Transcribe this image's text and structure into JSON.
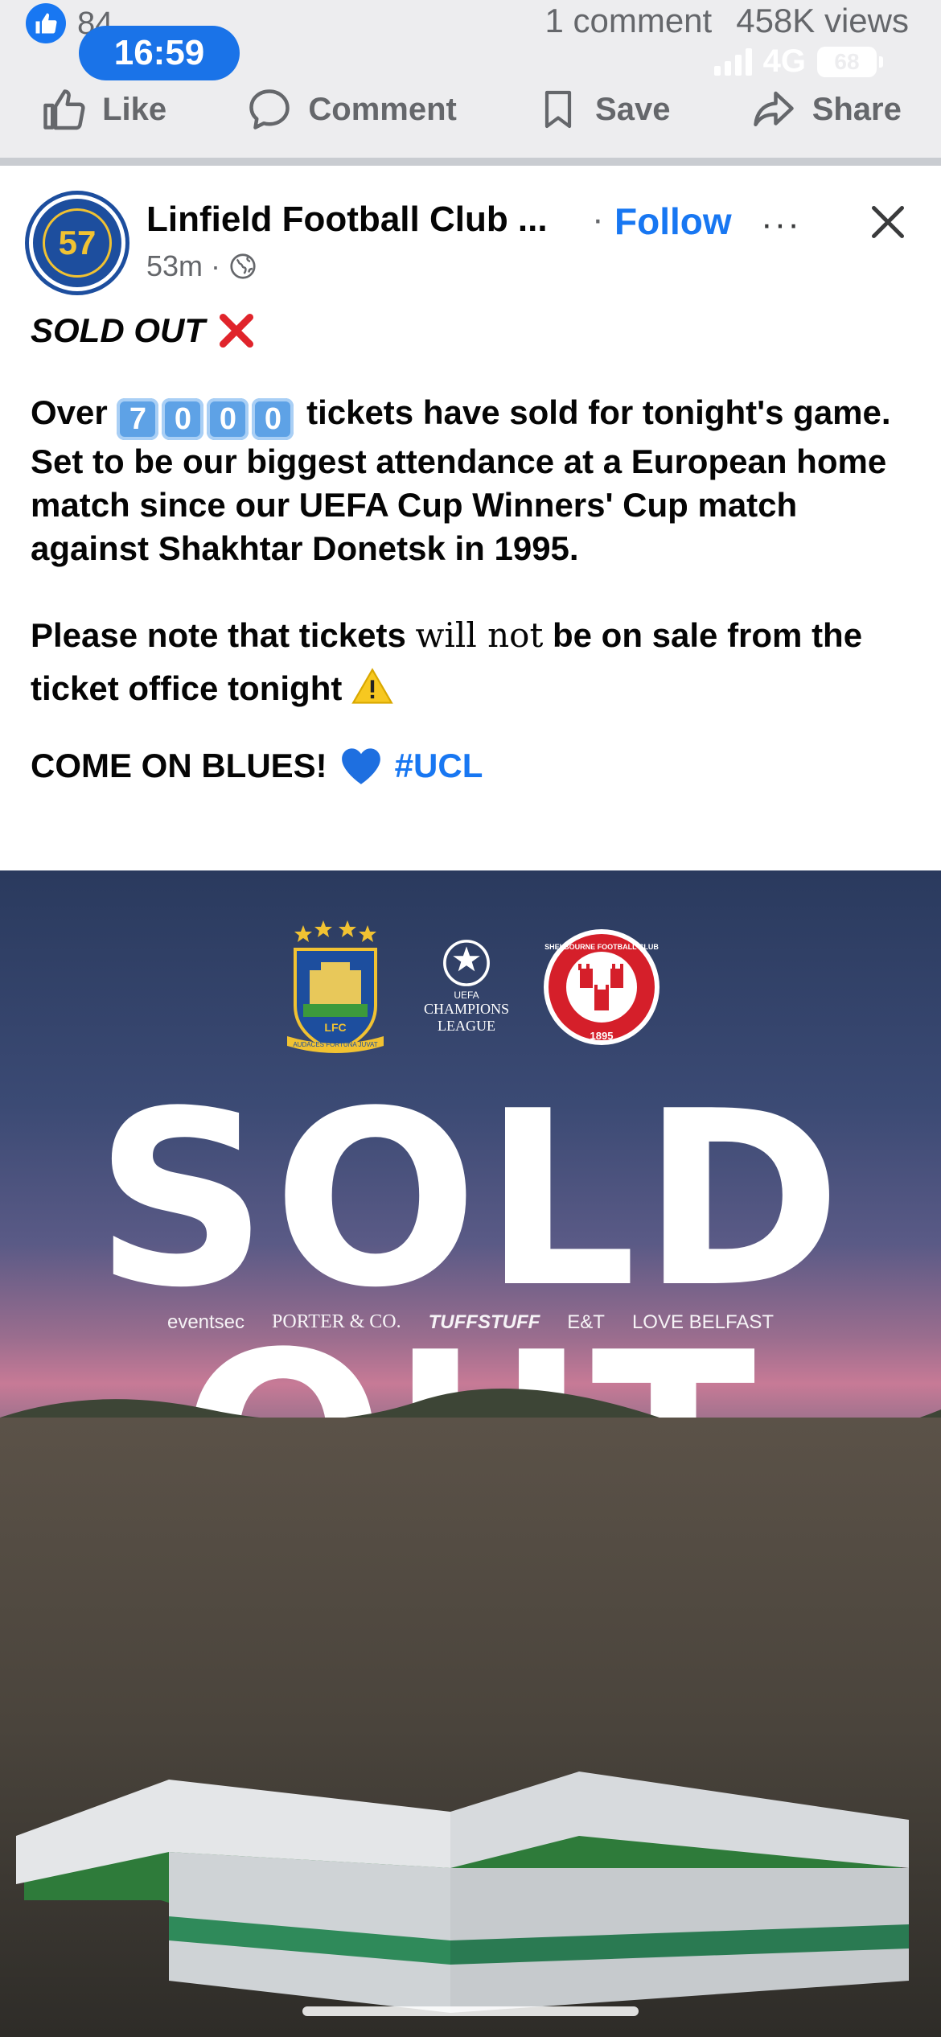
{
  "topbar": {
    "reaction_count": "84",
    "comments": "1 comment",
    "views": "458K views",
    "time": "16:59",
    "network": "4G",
    "battery": "68"
  },
  "actions": {
    "like": "Like",
    "comment": "Comment",
    "save": "Save",
    "share": "Share"
  },
  "post": {
    "page_name": "Linfield Football Club ...",
    "separator": "·",
    "follow": "Follow",
    "more": "···",
    "time_ago": "53m",
    "meta_sep": "·",
    "avatar_text": "57",
    "line1": "SOLD OUT",
    "over": "Over",
    "digits": [
      "7",
      "0",
      "0",
      "0"
    ],
    "para2_rest": "tickets have sold for tonight's game. Set to be our biggest attendance at a European home match since our UEFA Cup Winners' Cup match against Shakhtar Donetsk in 1995.",
    "para3_a": "Please note that tickets",
    "para3_b": "will not",
    "para3_c": "be on sale from the ticket office tonight",
    "para4": "COME ON BLUES!",
    "hashtag": "#UCL"
  },
  "poster": {
    "headline": "SOLD OUT",
    "lfc_text": "LFC",
    "lfc_motto": "AUDACES FORTUNA JUVAT",
    "ucl_line1": "CHAMPIONS",
    "ucl_line2": "LEAGUE",
    "ucl_small": "UEFA",
    "shelbourne_text": "SHELBOURNE FOOTBALL CLUB",
    "shelbourne_year": "1895",
    "sponsors": [
      "eventsec",
      "PORTER & CO.",
      "TUFFSTUFF",
      "E&T",
      "LOVE BELFAST"
    ]
  },
  "colors": {
    "accent": "#1877f2",
    "red_x": "#e0242b",
    "heart": "#1e6fe0"
  }
}
